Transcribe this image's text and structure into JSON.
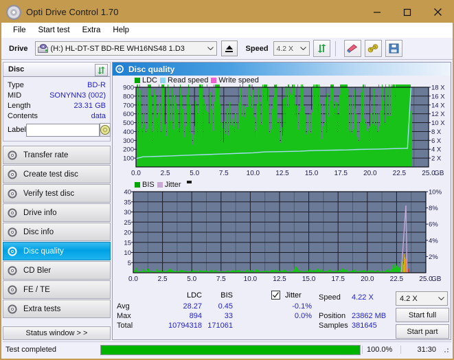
{
  "window": {
    "title": "Opti Drive Control 1.70",
    "icon": "disc-icon",
    "minimize": "minimize",
    "maximize": "maximize",
    "close": "close"
  },
  "menu": {
    "items": [
      "File",
      "Start test",
      "Extra",
      "Help"
    ]
  },
  "toolbar": {
    "drive_label": "Drive",
    "drive_value": "(H:)  HL-DT-ST BD-RE  WH16NS48 1.D3",
    "eject_label": "eject",
    "speed_label": "Speed",
    "speed_value": "4.2 X",
    "refresh_label": "refresh",
    "erase_label": "erase",
    "tools_label": "tools",
    "save_label": "save"
  },
  "disc_panel": {
    "title": "Disc",
    "refresh_label": "refresh",
    "fields": [
      {
        "key": "Type",
        "value": "BD-R"
      },
      {
        "key": "MID",
        "value": "SONYNN3 (002)"
      },
      {
        "key": "Length",
        "value": "23.31 GB"
      },
      {
        "key": "Contents",
        "value": "data"
      }
    ],
    "label_key": "Label",
    "label_value": "",
    "label_placeholder": ""
  },
  "nav": {
    "items": [
      {
        "label": "Transfer rate",
        "active": false
      },
      {
        "label": "Create test disc",
        "active": false
      },
      {
        "label": "Verify test disc",
        "active": false
      },
      {
        "label": "Drive info",
        "active": false
      },
      {
        "label": "Disc info",
        "active": false
      },
      {
        "label": "Disc quality",
        "active": true
      },
      {
        "label": "CD Bler",
        "active": false
      },
      {
        "label": "FE / TE",
        "active": false
      },
      {
        "label": "Extra tests",
        "active": false
      }
    ],
    "status_window": "Status window > >"
  },
  "main": {
    "header": "Disc quality",
    "header_icon": "disc-quality-icon"
  },
  "chart_data": [
    {
      "id": "ldc-chart",
      "type": "area",
      "title": "",
      "xlabel": "GB",
      "ylabel": "",
      "xlim": [
        0,
        25.0
      ],
      "xticks": [
        "0.0",
        "2.5",
        "5.0",
        "7.5",
        "10.0",
        "12.5",
        "15.0",
        "17.5",
        "20.0",
        "22.5",
        "25.0"
      ],
      "ylim": [
        0,
        900
      ],
      "yticks": [
        900,
        800,
        700,
        600,
        500,
        400,
        300,
        200,
        100
      ],
      "y2lim": [
        0,
        18
      ],
      "y2ticks": [
        "18 X",
        "16 X",
        "14 X",
        "12 X",
        "10 X",
        "8 X",
        "6 X",
        "4 X",
        "2 X"
      ],
      "grid": true,
      "legend": [
        "LDC",
        "Read speed",
        "Write speed"
      ],
      "legend_colors": [
        "#00A400",
        "#8FD4F0",
        "#F060D0"
      ],
      "legend_position": "top-left",
      "series": [
        {
          "name": "LDC",
          "color": "#19C219",
          "kind": "spikes",
          "x": [
            0.05,
            0.15,
            0.25,
            0.35,
            0.45,
            0.6,
            0.75,
            0.9,
            1.05,
            1.2,
            1.35,
            1.5,
            1.65,
            1.8,
            1.95,
            2.1,
            2.25,
            2.4,
            2.55,
            2.7,
            2.85,
            3.0,
            3.2,
            3.4,
            3.6,
            3.8,
            4.0,
            4.2,
            4.4,
            4.6,
            4.8,
            5.0,
            5.2,
            5.4,
            5.6,
            5.8,
            6.0,
            6.2,
            6.4,
            6.6,
            6.8,
            7.0,
            7.2,
            7.4,
            7.6,
            7.8,
            8.0,
            8.3,
            8.6,
            8.9,
            9.2,
            9.5,
            9.8,
            10.1,
            10.4,
            10.7,
            11.0,
            11.3,
            11.6,
            11.9,
            12.2,
            12.5,
            12.8,
            13.1,
            13.4,
            13.7,
            14.0,
            14.3,
            14.6,
            14.9,
            15.2,
            15.5,
            15.8,
            16.1,
            16.4,
            16.7,
            17.0,
            17.3,
            17.6,
            17.9,
            18.2,
            18.5,
            18.8,
            19.1,
            19.4,
            19.7,
            20.0,
            20.3,
            20.6,
            20.9,
            21.2,
            21.5,
            21.8,
            22.1,
            22.4,
            22.7,
            23.0,
            23.2,
            23.35,
            23.45,
            23.55
          ],
          "y": [
            390,
            120,
            95,
            250,
            110,
            80,
            140,
            100,
            180,
            320,
            90,
            130,
            110,
            95,
            200,
            70,
            440,
            130,
            90,
            230,
            85,
            120,
            160,
            95,
            85,
            140,
            110,
            90,
            130,
            100,
            80,
            95,
            110,
            200,
            130,
            90,
            210,
            150,
            95,
            120,
            240,
            310,
            95,
            80,
            120,
            90,
            105,
            110,
            85,
            160,
            130,
            110,
            240,
            95,
            120,
            90,
            300,
            130,
            95,
            270,
            110,
            85,
            160,
            230,
            260,
            95,
            180,
            120,
            85,
            100,
            170,
            210,
            95,
            160,
            110,
            250,
            140,
            90,
            260,
            200,
            95,
            130,
            110,
            80,
            170,
            95,
            110,
            140,
            90,
            200,
            160,
            130,
            220,
            260,
            420,
            870,
            640,
            300,
            180,
            120,
            90
          ]
        },
        {
          "name": "Read speed",
          "color": "#A5DCF5",
          "kind": "line",
          "x": [
            0.0,
            0.6,
            1.2,
            2.0,
            3.0,
            4.0,
            5.0,
            6.0,
            7.0,
            8.0,
            9.0,
            10.0,
            11.0,
            12.0,
            13.0,
            14.0,
            15.0,
            16.0,
            17.0,
            18.0,
            19.0,
            20.0,
            21.0,
            22.0,
            22.8,
            23.2,
            23.5
          ],
          "y_x_speed": [
            1.9,
            2.3,
            2.35,
            2.4,
            2.5,
            2.6,
            2.7,
            2.8,
            2.9,
            3.0,
            3.1,
            3.2,
            3.4,
            3.45,
            3.5,
            3.55,
            3.7,
            3.75,
            3.8,
            3.85,
            3.95,
            4.0,
            4.05,
            4.15,
            4.2,
            4.2,
            18.0
          ]
        }
      ]
    },
    {
      "id": "bis-jitter-chart",
      "type": "area",
      "title": "",
      "xlabel": "GB",
      "ylabel": "",
      "xlim": [
        0,
        25.0
      ],
      "xticks": [
        "0.0",
        "2.5",
        "5.0",
        "7.5",
        "10.0",
        "12.5",
        "15.0",
        "17.5",
        "20.0",
        "22.5",
        "25.0"
      ],
      "ylim": [
        0,
        40
      ],
      "yticks": [
        40,
        35,
        30,
        25,
        20,
        15,
        10,
        5
      ],
      "y2lim": [
        0,
        10
      ],
      "y2ticks": [
        "10%",
        "8%",
        "6%",
        "4%",
        "2%"
      ],
      "grid": true,
      "legend": [
        "BIS",
        "Jitter"
      ],
      "legend_colors": [
        "#00A400",
        "#C9A8D8"
      ],
      "legend_position": "top-left",
      "series": [
        {
          "name": "BIS",
          "color": "#19C219",
          "kind": "spikes",
          "x": [
            0.05,
            0.2,
            0.35,
            0.5,
            0.65,
            0.8,
            0.95,
            1.1,
            1.25,
            1.4,
            1.55,
            1.7,
            1.85,
            2.0,
            2.15,
            2.3,
            2.45,
            2.6,
            2.75,
            2.9,
            3.05,
            3.3,
            3.6,
            3.9,
            4.2,
            4.5,
            4.8,
            5.1,
            5.4,
            5.7,
            6.0,
            6.3,
            6.6,
            6.9,
            7.2,
            7.5,
            7.8,
            8.1,
            8.4,
            8.7,
            9.0,
            9.3,
            9.6,
            9.9,
            10.2,
            10.5,
            10.8,
            11.1,
            11.4,
            11.7,
            12.0,
            12.3,
            12.6,
            12.9,
            13.2,
            13.5,
            13.8,
            14.1,
            14.4,
            14.7,
            15.0,
            15.3,
            15.6,
            15.9,
            16.2,
            16.5,
            16.8,
            17.1,
            17.4,
            17.7,
            18.0,
            18.3,
            18.6,
            18.9,
            19.2,
            19.5,
            19.8,
            20.1,
            20.4,
            20.7,
            21.0,
            21.3,
            21.6,
            21.9,
            22.2,
            22.5,
            22.8,
            23.0,
            23.15,
            23.3,
            23.4,
            23.5
          ],
          "y": [
            2,
            9,
            4,
            5,
            3,
            6,
            4,
            5,
            7,
            3,
            5,
            4,
            3,
            6,
            4,
            9,
            3,
            5,
            4,
            3,
            6,
            4,
            3,
            5,
            4,
            3,
            4,
            5,
            3,
            4,
            6,
            3,
            4,
            5,
            3,
            5,
            4,
            3,
            6,
            4,
            5,
            3,
            4,
            6,
            3,
            5,
            4,
            3,
            5,
            4,
            6,
            3,
            4,
            5,
            3,
            4,
            11,
            5,
            4,
            3,
            6,
            4,
            5,
            8,
            4,
            3,
            5,
            4,
            3,
            6,
            9,
            4,
            3,
            5,
            4,
            3,
            6,
            4,
            5,
            3,
            4,
            6,
            5,
            8,
            12,
            16,
            20,
            28,
            34,
            24,
            14,
            6
          ]
        },
        {
          "name": "Jitter",
          "color": "#C9A8D8",
          "kind": "line",
          "x": [
            0.0,
            22.9,
            23.3,
            23.4
          ],
          "y_pct": [
            0.0,
            0.0,
            8.3,
            0.0
          ]
        }
      ]
    }
  ],
  "stats": {
    "col_headers": [
      "LDC",
      "BIS"
    ],
    "jitter_label": "Jitter",
    "jitter_checked": true,
    "rows": [
      {
        "label": "Avg",
        "ldc": "28.27",
        "bis": "0.45",
        "jitter": "-0.1%"
      },
      {
        "label": "Max",
        "ldc": "894",
        "bis": "33",
        "jitter": "0.0%"
      },
      {
        "label": "Total",
        "ldc": "10794318",
        "bis": "171061",
        "jitter": ""
      }
    ],
    "speed_label": "Speed",
    "speed_value": "4.22 X",
    "speed_select": "4.2 X",
    "position_label": "Position",
    "position_value": "23862 MB",
    "samples_label": "Samples",
    "samples_value": "381645",
    "start_full": "Start full",
    "start_part": "Start part"
  },
  "statusbar": {
    "text": "Test completed",
    "progress_pct": 100.0,
    "progress_text": "100.0%",
    "elapsed": "31:30"
  }
}
